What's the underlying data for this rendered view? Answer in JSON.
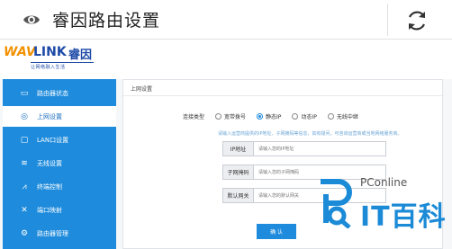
{
  "browser": {
    "title": "睿因路由设置",
    "eye_icon": "eye-icon",
    "refresh_icon": "refresh-icon"
  },
  "brand": {
    "logo_wav": "WAV",
    "logo_link": "LINK",
    "logo_cn": "睿因",
    "slogan": "让网络融入生活"
  },
  "sidebar": {
    "items": [
      {
        "label": "路由器状态",
        "icon": "monitor-icon"
      },
      {
        "label": "上网设置",
        "icon": "globe-icon"
      },
      {
        "label": "LAN口设置",
        "icon": "lan-port-icon"
      },
      {
        "label": "无线设置",
        "icon": "wifi-icon"
      },
      {
        "label": "终端控制",
        "icon": "chart-icon"
      },
      {
        "label": "端口映射",
        "icon": "tools-icon"
      },
      {
        "label": "路由器管理",
        "icon": "gear-icon"
      }
    ],
    "active_index": 1
  },
  "panel": {
    "title": "上网设置",
    "conn_label": "连接类型",
    "conn_options": [
      "宽带拨号",
      "静态IP",
      "动态IP",
      "无线中继"
    ],
    "conn_selected": "静态IP",
    "hint": "请输入运营商提供的IP地址、子网掩码等信息，如有疑问，可咨询运营商或当地网络服务商。",
    "fields": [
      {
        "label": "IP地址",
        "placeholder": "请输入您的IP地址"
      },
      {
        "label": "子网掩码",
        "placeholder": "请输入您的子网掩码"
      },
      {
        "label": "默认网关",
        "placeholder": "请输入您的默认网关"
      }
    ],
    "ok_label": "确 认"
  },
  "watermark": {
    "pconline": "PConline",
    "itbaike": "IT百科"
  },
  "colors": {
    "sidebar_blue": "#1e8bdc",
    "brand_orange": "#f29100",
    "brand_blue": "#1d4aa7"
  }
}
